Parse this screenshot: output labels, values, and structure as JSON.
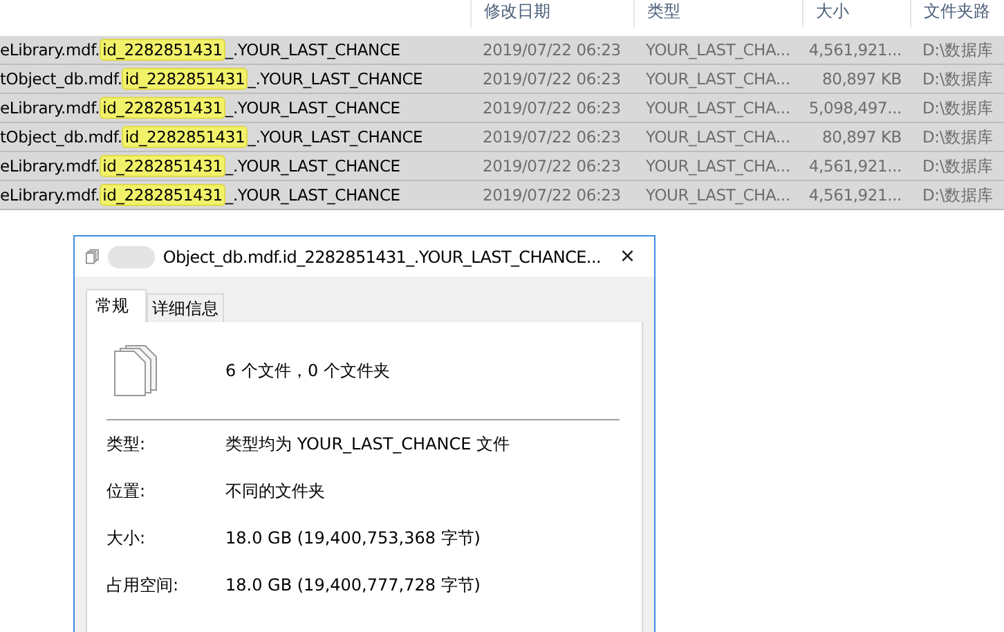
{
  "file_list": {
    "columns": [
      {
        "label": "修改日期"
      },
      {
        "label": "类型"
      },
      {
        "label": "大小"
      },
      {
        "label": "文件夹路"
      }
    ],
    "rows": [
      {
        "name_start": "eLibrary.mdf.",
        "name_match": "id_2282851431",
        "name_end": "_.YOUR_LAST_CHANCE",
        "date": "2019/07/22 06:23",
        "type": "YOUR_LAST_CHA...",
        "size": "4,561,921...",
        "path": "D:\\数据库"
      },
      {
        "name_start": "tObject_db.mdf.",
        "name_match": "id_2282851431",
        "name_end": "_.YOUR_LAST_CHANCE",
        "date": "2019/07/22 06:23",
        "type": "YOUR_LAST_CHA...",
        "size": "80,897 KB",
        "path": "D:\\数据库"
      },
      {
        "name_start": "eLibrary.mdf.",
        "name_match": "id_2282851431",
        "name_end": "_.YOUR_LAST_CHANCE",
        "date": "2019/07/22 06:23",
        "type": "YOUR_LAST_CHA...",
        "size": "5,098,497...",
        "path": "D:\\数据库"
      },
      {
        "name_start": "tObject_db.mdf.",
        "name_match": "id_2282851431",
        "name_end": "_.YOUR_LAST_CHANCE",
        "date": "2019/07/22 06:23",
        "type": "YOUR_LAST_CHA...",
        "size": "80,897 KB",
        "path": "D:\\数据库"
      },
      {
        "name_start": "eLibrary.mdf.",
        "name_match": "id_2282851431",
        "name_end": "_.YOUR_LAST_CHANCE",
        "date": "2019/07/22 06:23",
        "type": "YOUR_LAST_CHA...",
        "size": "4,561,921...",
        "path": "D:\\数据库"
      },
      {
        "name_start": "eLibrary.mdf.",
        "name_match": "id_2282851431",
        "name_end": "_.YOUR_LAST_CHANCE",
        "date": "2019/07/22 06:23",
        "type": "YOUR_LAST_CHA...",
        "size": "4,561,921...",
        "path": "D:\\数据库"
      }
    ]
  },
  "dialog": {
    "title": "Object_db.mdf.id_2282851431_.YOUR_LAST_CHANCE...",
    "close": "×",
    "tabs": [
      {
        "label": "常规",
        "selected": true
      },
      {
        "label": "详细信息",
        "selected": false
      }
    ],
    "summary": "6 个文件，0 个文件夹",
    "properties": [
      {
        "label": "类型:",
        "value": "类型均为 YOUR_LAST_CHANCE 文件"
      },
      {
        "label": "位置:",
        "value": "不同的文件夹"
      },
      {
        "label": "大小:",
        "value": "18.0 GB (19,400,753,368 字节)"
      },
      {
        "label": "占用空间:",
        "value": "18.0 GB (19,400,777,728 字节)"
      }
    ]
  }
}
